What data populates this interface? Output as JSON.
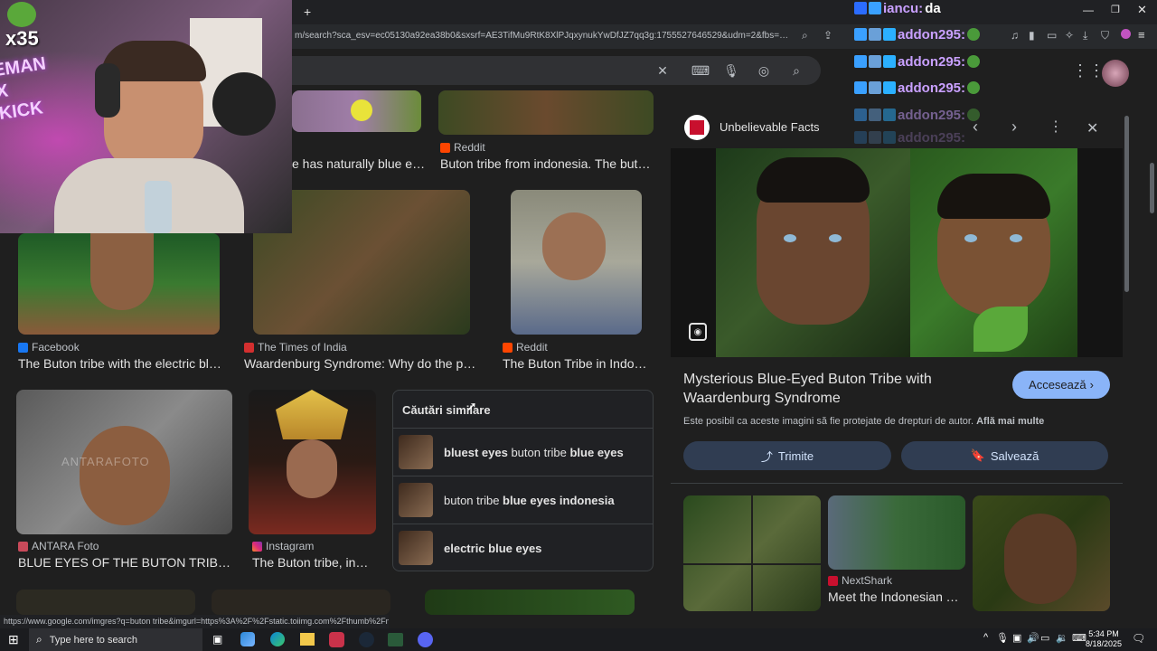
{
  "browser": {
    "url": "m/search?sca_esv=ec05130a92ea38b0&sxsrf=AE3TifMu9RtK8XlPJqxynukYwDfJZ7qq3g:1755527646529&udm=2&fbs=AIljpHxX5k-tO...",
    "new_tab_symbol": "+",
    "status_url": "https://www.google.com/imgres?q=buton tribe&imgurl=https%3A%2F%2Fstatic.toiimg.com%2Fthumb%2Fmsid-120..."
  },
  "stream_overlay": {
    "multiplier": "x35",
    "shirt_text": "EMAN X KICK"
  },
  "chat": [
    {
      "user": "iancu:",
      "msg": "da"
    },
    {
      "user": "addon295:",
      "msg": ""
    },
    {
      "user": "addon295:",
      "msg": ""
    },
    {
      "user": "addon295:",
      "msg": ""
    },
    {
      "user": "addon295:",
      "msg": ""
    },
    {
      "user": "addon295:",
      "msg": ""
    }
  ],
  "results": [
    {
      "source": "",
      "caption": "e has naturally blue ey..."
    },
    {
      "source": "Reddit",
      "caption": "Buton tribe from indonesia. The buton ..."
    },
    {
      "source": "Facebook",
      "caption": "The Buton tribe with the electric blue ..."
    },
    {
      "source": "The Times of India",
      "caption": "Waardenburg Syndrome: Why do the peopl..."
    },
    {
      "source": "Reddit",
      "caption": "The Buton Tribe in Indone..."
    },
    {
      "source": "ANTARA Foto",
      "caption": "BLUE EYES OF THE BUTON TRIBE | ..."
    },
    {
      "source": "Instagram",
      "caption": "The Buton tribe, inha..."
    }
  ],
  "watermark": "ANTARAFOTO",
  "related": {
    "title": "Căutări similare",
    "items": [
      {
        "bold1": "bluest eyes",
        "plain": " buton tribe ",
        "bold2": "blue eyes"
      },
      {
        "bold1": "",
        "plain": "buton tribe ",
        "bold2": "blue eyes indonesia"
      },
      {
        "bold1": "electric blue eyes",
        "plain": "",
        "bold2": ""
      }
    ]
  },
  "panel": {
    "site": "Unbelievable Facts",
    "title": "Mysterious Blue-Eyed Buton Tribe with Waardenburg Syndrome",
    "visit_label": "Accesează",
    "copyright_text": "Este posibil ca aceste imagini să fie protejate de drepturi de autor.",
    "learn_more": "Află mai multe",
    "share_label": "Trimite",
    "save_label": "Salvează",
    "related_source": "NextShark",
    "related_caption": "Meet the Indonesian Tri..."
  },
  "taskbar": {
    "search_placeholder": "Type here to search",
    "time": "5:34 PM",
    "date": "8/18/2025"
  },
  "colors": {
    "accent_blue": "#8ab4f8",
    "visit_button_bg": "#8ab4f8",
    "chat_user": "#c9a0ff"
  }
}
